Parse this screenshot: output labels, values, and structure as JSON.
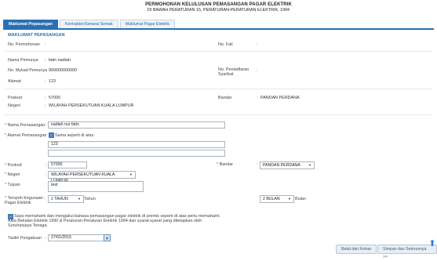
{
  "header": {
    "title": "PERMOHONAN KELULUSAN PEMASANGAN PAGAR ELEKTRIK",
    "subtitle": "DI BAWAH PERATURAN 15, PERATURAN-PERATURAN ELEKTRIK, 1994"
  },
  "tabs": [
    {
      "label": "Maklumat Pepasangan",
      "active": true
    },
    {
      "label": "Kontraktor/Senarai Semak",
      "active": false
    },
    {
      "label": "Maklumat Pagar Elektrik",
      "active": false
    }
  ],
  "section_title": "MAKLUMAT PEPASANGAN",
  "info": {
    "no_permohonan": {
      "label": "No. Permohonan",
      "value": ""
    },
    "no_fail": {
      "label": "No. Fail",
      "value": ""
    },
    "nama_pemunya": {
      "label": "Nama Pemunya",
      "value": "fatin nadiah"
    },
    "no_mykad": {
      "label": "No. Mykad Pemunya",
      "value": "900000000000"
    },
    "no_pendaftaran": {
      "label": "No. Pendaftaran Syarikat",
      "value": ""
    },
    "alamat": {
      "label": "Alamat",
      "value": "123"
    },
    "poskod": {
      "label": "Poskod",
      "value": "57000"
    },
    "bandar": {
      "label": "Bandar",
      "value": "PANDAN PERDANA"
    },
    "negeri": {
      "label": "Negeri",
      "value": "WILAYAH PERSEKUTUAN KUALA LUMPUR"
    }
  },
  "form": {
    "nama_pemasangan": {
      "label": "Nama Pemasangan",
      "value": "nadiah nur fatin"
    },
    "alamat_pemasangan": {
      "label": "Alamat Pemasangan",
      "checkbox_label": "Sama seperti di atas.",
      "line1": "123",
      "line2": ""
    },
    "poskod": {
      "label": "Poskod",
      "value": "57000"
    },
    "bandar": {
      "label": "Bandar",
      "value": "PANDAN PERDANA"
    },
    "negeri": {
      "label": "Negeri",
      "value": "WILAYAH PERSEKUTUAN KUALA LUMPUR"
    },
    "tujuan": {
      "label": "Tujuan",
      "value": "test"
    },
    "tempoh": {
      "label": "Tempoh Kegunaan Pagar Elektrik",
      "tahun_value": "1 TAHUN",
      "tahun_label": "Tahun",
      "bulan_value": "2 BULAN",
      "bulan_label": "Bulan"
    },
    "declaration": "Saya memahami dan mengakui bahasa pemasangan pagar elektrik di premis seperti di atas perlu memahami Akta Bekalan Elektrik 1990 & Peraturan-Peraturan Elektrik 1994 dan syarat-syarat yang ditetapkan oleh Suruhanjaya Tenaga.",
    "declaration_l1": "Saya memahami dan mengakui bahasa pemasangan pagar elektrik di premis seperti di atas perlu memahami.",
    "declaration_l2": "Akta Bekalan Elektrik 1990 & Peraturan-Peraturan Elektrik 1994 dan syarat-syarat yang ditetapkan oleh",
    "declaration_l3": "Suruhanjaya Tenaga.",
    "tarikh": {
      "label": "Tarikh Pengakuan",
      "value": "27/01/2015"
    }
  },
  "buttons": {
    "batal": "Batal dan Keluar",
    "simpan": "Simpan dan Seterusnya >>"
  },
  "colors": {
    "accent": "#2a6fb2",
    "border": "#a9b4bf"
  }
}
